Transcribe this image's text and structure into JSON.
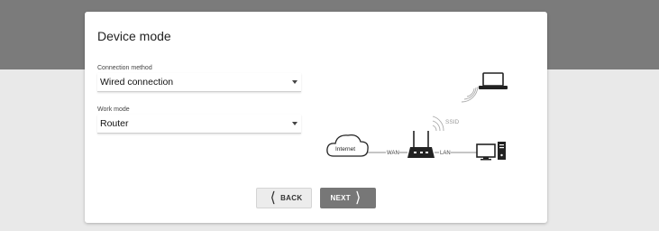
{
  "page": {
    "title": "Device mode"
  },
  "connection": {
    "label": "Connection method",
    "value": "Wired connection"
  },
  "work_mode": {
    "label": "Work mode",
    "value": "Router"
  },
  "buttons": {
    "back": "BACK",
    "next": "NEXT"
  },
  "diagram": {
    "internet": "Internet",
    "wan": "WAN",
    "lan": "LAN",
    "ssid": "SSID"
  }
}
